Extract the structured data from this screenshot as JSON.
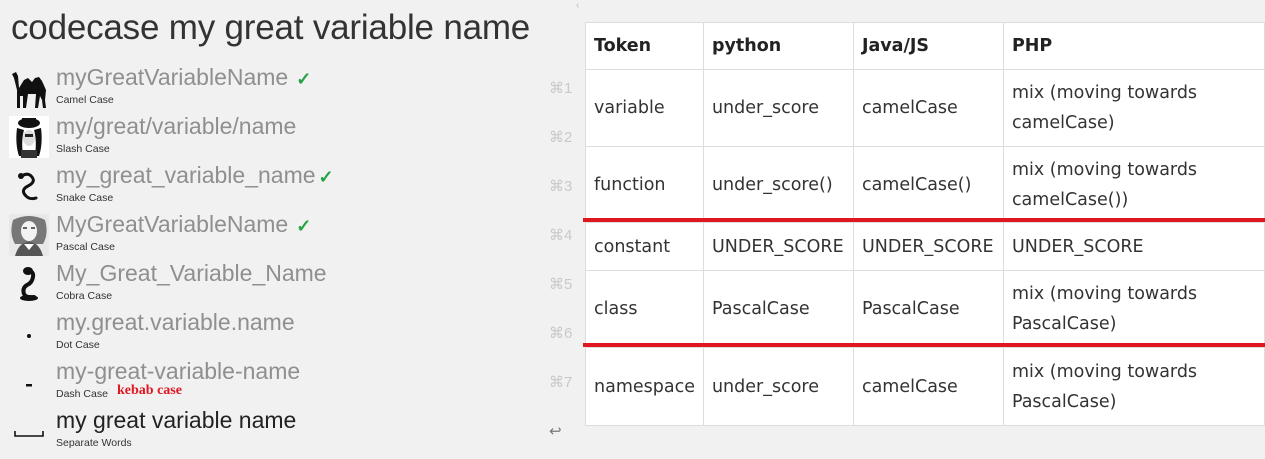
{
  "query": "codecase my great variable name",
  "rows": [
    {
      "name": "myGreatVariableName",
      "sub": "Camel Case",
      "sc": "⌘1",
      "check": "✓",
      "icon": "camel-icon"
    },
    {
      "name": "my/great/variable/name",
      "sub": "Slash Case",
      "sc": "⌘2",
      "check": "",
      "icon": "slash-portrait-icon"
    },
    {
      "name": "my_great_variable_name",
      "sub": "Snake Case",
      "sc": "⌘3",
      "check": "✓",
      "icon": "snake-icon"
    },
    {
      "name": "MyGreatVariableName",
      "sub": "Pascal Case",
      "sc": "⌘4",
      "check": "✓",
      "icon": "pascal-portrait-icon"
    },
    {
      "name": "My_Great_Variable_Name",
      "sub": "Cobra Case",
      "sc": "⌘5",
      "check": "",
      "icon": "cobra-icon"
    },
    {
      "name": "my.great.variable.name",
      "sub": "Dot Case",
      "sc": "⌘6",
      "check": "",
      "icon": "dot-icon"
    },
    {
      "name": "my-great-variable-name",
      "sub": "Dash Case",
      "sc": "⌘7",
      "check": "",
      "icon": "dash-icon",
      "note": "kebab case"
    },
    {
      "name": "my great variable name",
      "sub": "Separate Words",
      "sc": "↩",
      "check": "",
      "icon": "space-icon"
    }
  ],
  "table": {
    "headers": [
      "Token",
      "python",
      "Java/JS",
      "PHP"
    ],
    "rows": [
      [
        "variable",
        "under_score",
        "camelCase",
        "mix (moving towards camelCase)"
      ],
      [
        "function",
        "under_score()",
        "camelCase()",
        "mix (moving towards camelCase())"
      ],
      [
        "constant",
        "UNDER_SCORE",
        "UNDER_SCORE",
        "UNDER_SCORE"
      ],
      [
        "class",
        "PascalCase",
        "PascalCase",
        "mix (moving towards PascalCase)"
      ],
      [
        "namespace",
        "under_score",
        "camelCase",
        "mix (moving towards PascalCase)"
      ]
    ]
  },
  "colors": {
    "accent_red": "#e0171f",
    "check_green": "#25a244"
  }
}
